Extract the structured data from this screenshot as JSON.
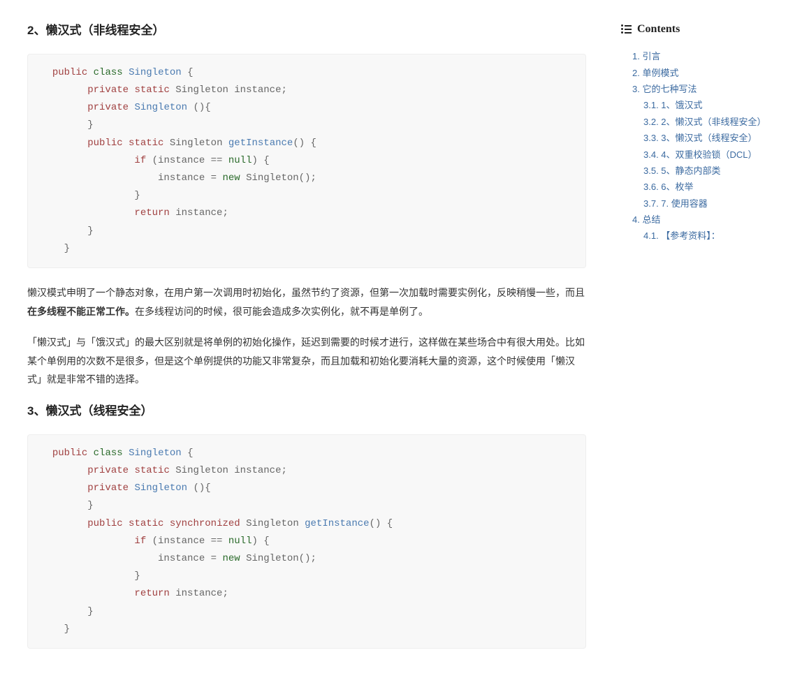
{
  "headings": {
    "h2": "2、懒汉式（非线程安全）",
    "h3": "3、懒汉式（线程安全）"
  },
  "code1": {
    "l1a": "public",
    "l1b": "class",
    "l1c": "Singleton",
    "l1d": " {",
    "l2a": "private",
    "l2b": "static",
    "l2c": " Singleton instance;",
    "l3a": "private",
    "l3b": "Singleton",
    "l3c": " (){",
    "l4": "        }",
    "l5a": "public",
    "l5b": "static",
    "l5c": " Singleton ",
    "l5d": "getInstance",
    "l5e": "() {",
    "l6a": "if",
    "l6b": " (instance == ",
    "l6c": "null",
    "l6d": ") {",
    "l7a": "                    instance = ",
    "l7b": "new",
    "l7c": " Singleton();",
    "l8": "                }",
    "l9a": "return",
    "l9b": " instance;",
    "l10": "        }",
    "l11": "    }"
  },
  "paragraphs": {
    "p1_a": "懒汉模式申明了一个静态对象，在用户第一次调用时初始化，虽然节约了资源，但第一次加载时需要实例化，反映稍慢一些，而且",
    "p1_b": "在多线程不能正常工作。",
    "p1_c": "在多线程访问的时候，很可能会造成多次实例化，就不再是单例了。",
    "p2": "「懒汉式」与「饿汉式」的最大区别就是将单例的初始化操作，延迟到需要的时候才进行，这样做在某些场合中有很大用处。比如某个单例用的次数不是很多，但是这个单例提供的功能又非常复杂，而且加载和初始化要消耗大量的资源，这个时候使用「懒汉式」就是非常不错的选择。"
  },
  "code2": {
    "l1a": "public",
    "l1b": "class",
    "l1c": "Singleton",
    "l1d": " {",
    "l2a": "private",
    "l2b": "static",
    "l2c": " Singleton instance;",
    "l3a": "private",
    "l3b": "Singleton",
    "l3c": " (){",
    "l4": "        }",
    "l5a": "public",
    "l5b": "static",
    "l5c": "synchronized",
    "l5d": " Singleton ",
    "l5e": "getInstance",
    "l5f": "() {",
    "l6a": "if",
    "l6b": " (instance == ",
    "l6c": "null",
    "l6d": ") {",
    "l7a": "                    instance = ",
    "l7b": "new",
    "l7c": " Singleton();",
    "l8": "                }",
    "l9a": "return",
    "l9b": " instance;",
    "l10": "        }",
    "l11": "    }"
  },
  "toc": {
    "title": "Contents",
    "items": [
      {
        "label": "1. 引言",
        "lvl": 1
      },
      {
        "label": "2. 单例模式",
        "lvl": 1
      },
      {
        "label": "3. 它的七种写法",
        "lvl": 1
      },
      {
        "label": "3.1. 1、饿汉式",
        "lvl": 2
      },
      {
        "label": "3.2. 2、懒汉式（非线程安全）",
        "lvl": 2
      },
      {
        "label": "3.3. 3、懒汉式（线程安全）",
        "lvl": 2
      },
      {
        "label": "3.4. 4、双重校验锁（DCL）",
        "lvl": 2
      },
      {
        "label": "3.5. 5、静态内部类",
        "lvl": 2
      },
      {
        "label": "3.6. 6、枚举",
        "lvl": 2
      },
      {
        "label": "3.7. 7. 使用容器",
        "lvl": 2
      },
      {
        "label": "4. 总结",
        "lvl": 1
      },
      {
        "label": "4.1. 【参考资料】：",
        "lvl": 2
      }
    ]
  }
}
